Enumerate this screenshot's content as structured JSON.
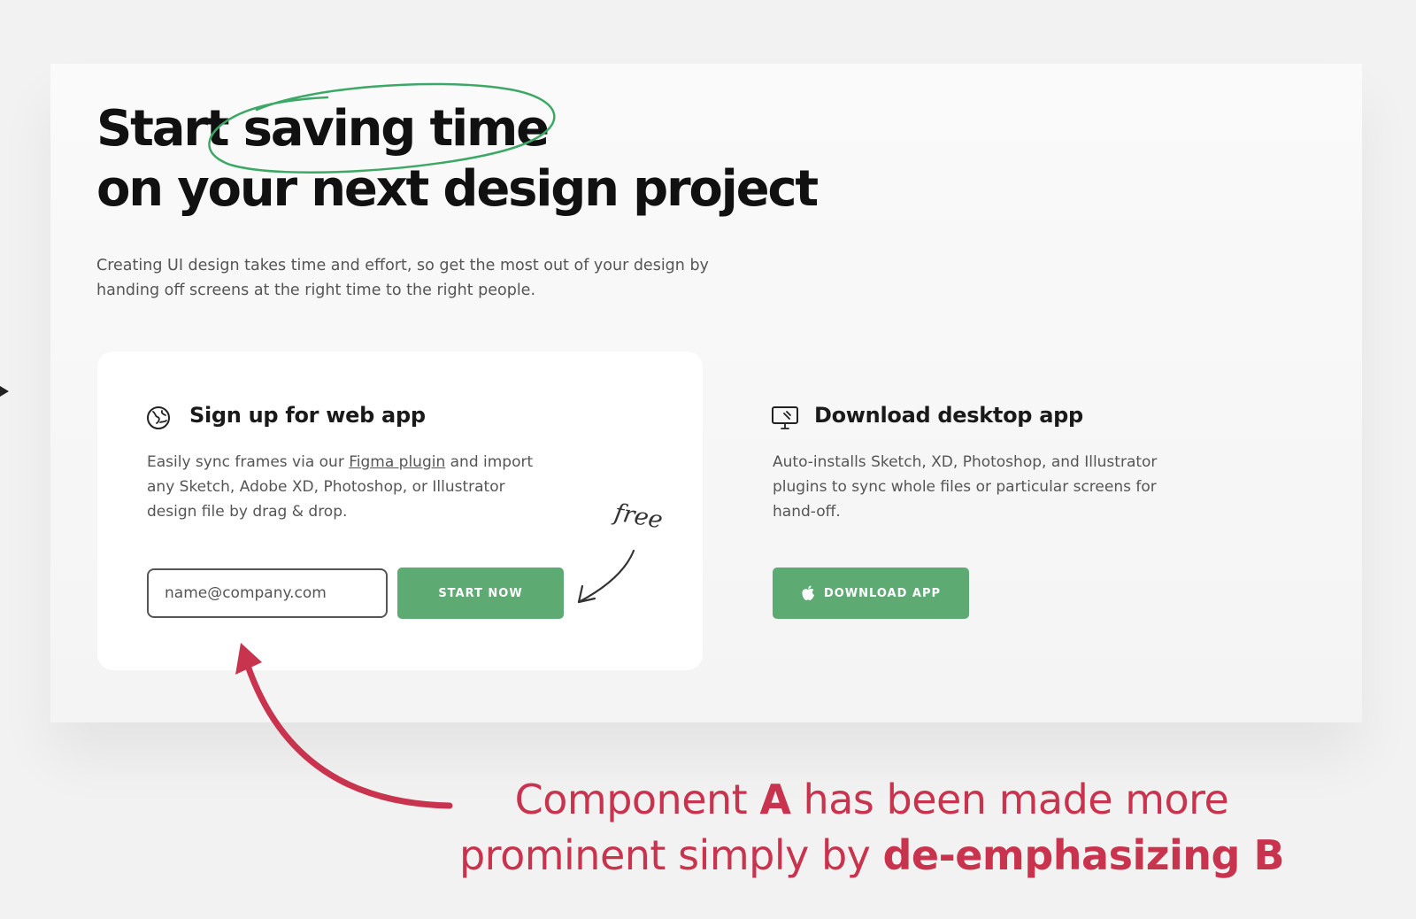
{
  "hero": {
    "headline_line1": "Start saving time",
    "headline_line2": "on your next design project",
    "subtitle": "Creating UI design takes time and effort, so get the most out of your design by handing off screens at the right time to the right people."
  },
  "card_a": {
    "icon": "globe-icon",
    "title": "Sign up for web app",
    "desc_part1": "Easily sync frames via our ",
    "desc_link": "Figma plugin",
    "desc_part2": " and import any Sketch, Adobe XD, Photoshop, or Illustrator design file by drag & drop.",
    "email_placeholder": "name@company.com",
    "button_label": "START NOW",
    "free_note": "free"
  },
  "card_b": {
    "icon": "desktop-monitor-icon",
    "title": "Download desktop app",
    "desc": "Auto-installs Sketch, XD, Photoshop, and Illustrator plugins to sync whole files or particular screens for hand-off.",
    "button_icon": "apple-icon",
    "button_label": "DOWNLOAD APP"
  },
  "annotation": {
    "line1_a": "Component ",
    "line1_b": "A",
    "line1_c": " has been made more",
    "line2_a": "prominent simply by ",
    "line2_b": "de-emphasizing B"
  },
  "colors": {
    "accent_green": "#5daa73",
    "annotation_red": "#c8334d",
    "highlight_circle": "#3da866"
  }
}
